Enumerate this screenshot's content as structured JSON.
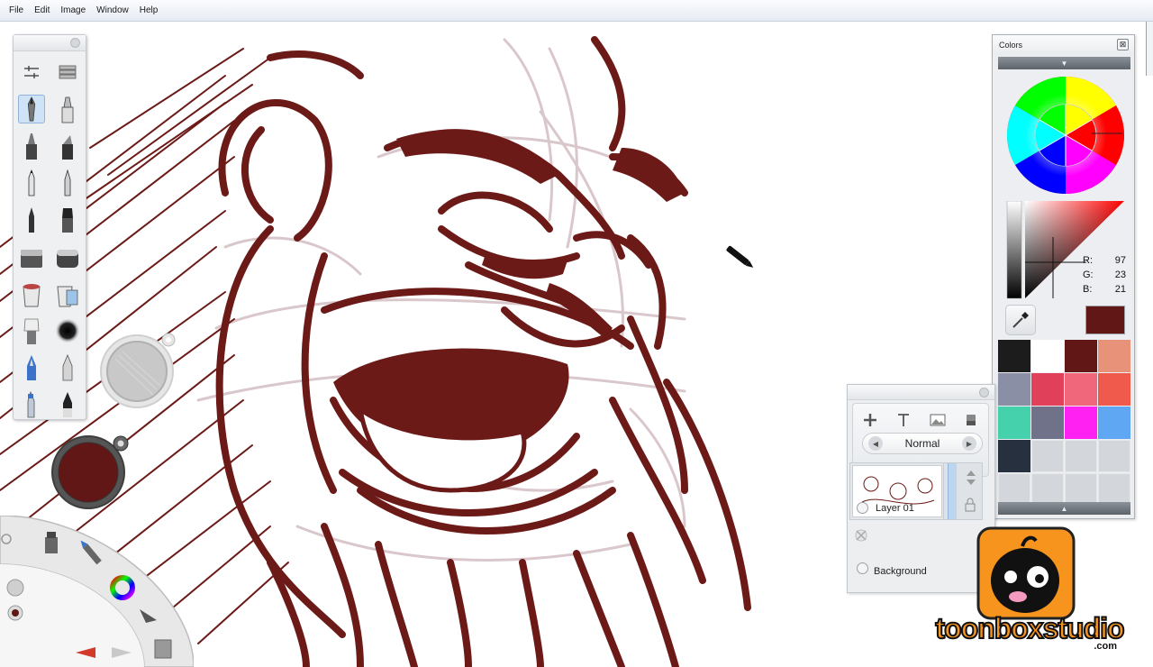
{
  "menu": {
    "items": [
      "File",
      "Edit",
      "Image",
      "Window",
      "Help"
    ]
  },
  "toolbox": {
    "tools": [
      "brush-settings-icon",
      "layers-editor-icon",
      "pencil-icon",
      "marker-icon",
      "felt-pen-icon",
      "chisel-marker-icon",
      "ballpoint-pen-icon",
      "fine-pen-icon",
      "ink-pen-icon",
      "paint-brush-icon",
      "eraser-icon",
      "hard-eraser-icon",
      "paint-bucket-icon",
      "multi-bucket-icon",
      "flat-brush-icon",
      "soft-airbrush-icon",
      "fountain-pen-icon",
      "calligraphy-pen-icon",
      "airbrush-icon",
      "smudge-icon"
    ],
    "selected": "pencil-icon"
  },
  "colors_panel": {
    "title": "Colors",
    "close": "⊠",
    "rgb": {
      "r_label": "R:",
      "r_value": "97",
      "g_label": "G:",
      "g_value": "23",
      "b_label": "B:",
      "b_value": "21"
    },
    "current_color": "#611715",
    "swatches": [
      "#1c1c1c",
      "#ffffff",
      "#611715",
      "#e8927a",
      "#8a8fa5",
      "#e0405a",
      "#f0677c",
      "#ef5a4c",
      "#46d1ad",
      "#6f7289",
      "#ff20f2",
      "#5fa7f2",
      "#26303f",
      "",
      "",
      "",
      "",
      "",
      "",
      ""
    ]
  },
  "layers_panel": {
    "blend_mode": "Normal",
    "layers": [
      {
        "name": "Layer 01"
      },
      {
        "name": "Background"
      }
    ]
  },
  "logo": {
    "text": "toonboxstudio",
    "suffix": ".com"
  },
  "accent_colors": {
    "ink": "#6b1a17",
    "sketch": "#d6c4c8"
  }
}
